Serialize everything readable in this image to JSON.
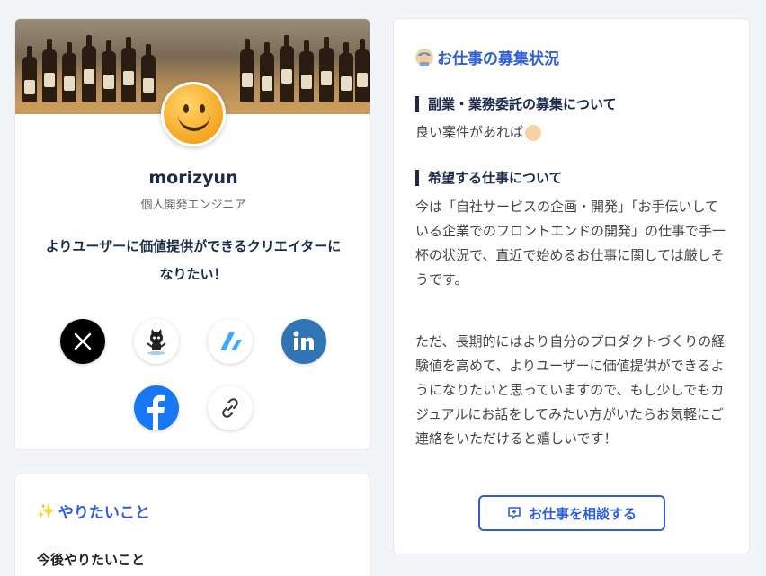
{
  "profile": {
    "name": "morizyun",
    "role": "個人開発エンジニア",
    "bio": "よりユーザーに価値提供ができるクリエイターになりたい！",
    "social": [
      {
        "icon": "x-icon",
        "label": "X"
      },
      {
        "icon": "github-icon",
        "label": "GitHub"
      },
      {
        "icon": "zenn-icon",
        "label": "Zenn"
      },
      {
        "icon": "linkedin-icon",
        "label": "in"
      },
      {
        "icon": "facebook-icon",
        "label": "f"
      },
      {
        "icon": "link-icon",
        "label": "link"
      }
    ]
  },
  "jobs": {
    "title": "お仕事の募集状況",
    "side_job_heading": "副業・業務委託の募集について",
    "side_job_text": "良い案件があれば",
    "desired_heading": "希望する仕事について",
    "desired_text_1": "今は「自社サービスの企画・開発」「お手伝いしている企業でのフロントエンドの開発」の仕事で手一杯の状況で、直近で始めるお仕事に関しては厳しそうです。",
    "desired_text_2": "ただ、長期的にはより自分のプロダクトづくりの経験値を高めて、よりユーザーに価値提供ができるようになりたいと思っていますので、もし少しでもカジュアルにお話をしてみたい方がいたらお気軽にご連絡をいただけると嬉しいです！",
    "consult_button": "お仕事を相談する"
  },
  "wants": {
    "title": "やりたいこと",
    "sub_heading": "今後やりたいこと"
  },
  "colors": {
    "accent": "#2f5dd8",
    "heading": "#1c2b4a",
    "linkedin": "#2f75b5",
    "facebook": "#1877f2"
  }
}
